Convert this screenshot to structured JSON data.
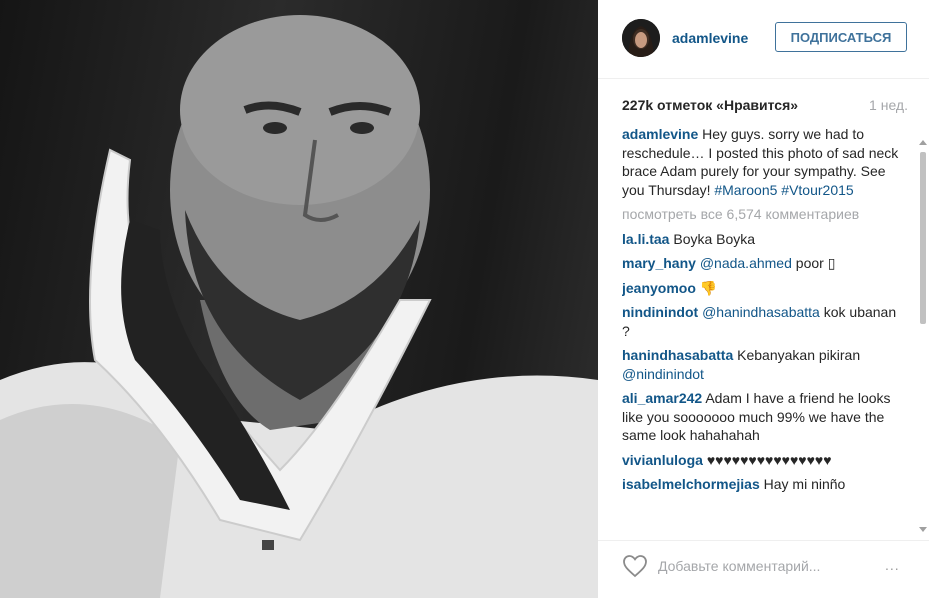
{
  "photo": {
    "description_icon": "photo-icon"
  },
  "header": {
    "username": "adamlevine",
    "follow_label": "ПОДПИСАТЬСЯ"
  },
  "stats": {
    "likes": "227k отметок «Нравится»",
    "ago": "1 нед."
  },
  "caption": {
    "user": "adamlevine",
    "text": "Hey guys. sorry we had to reschedule… I posted this photo of sad neck brace Adam purely for your sympathy. See you Thursday!",
    "tag1": "#Maroon5",
    "tag2": "#Vtour2015"
  },
  "view_all": "посмотреть все 6,574 комментариев",
  "comments": [
    {
      "user": "la.li.taa",
      "mention": "",
      "text": "Boyka Boyka"
    },
    {
      "user": "mary_hany",
      "mention": "@nada.ahmed",
      "text": "poor ▯"
    },
    {
      "user": "jeanyomoo",
      "mention": "",
      "text": "👎"
    },
    {
      "user": "nindinindot",
      "mention": "@hanindhasabatta",
      "text": "kok ubanan ?"
    },
    {
      "user": "hanindhasabatta",
      "mention": "",
      "text": "Kebanyakan pikiran",
      "mention2": "@nindinindot"
    },
    {
      "user": "ali_amar242",
      "mention": "",
      "text": "Adam I have a friend he looks like you sooooooo much 99% we have the same look hahahahah"
    },
    {
      "user": "vivianluloga",
      "mention": "",
      "text": "♥♥♥♥♥♥♥♥♥♥♥♥♥♥♥"
    },
    {
      "user": "isabelmelchormejias",
      "mention": "",
      "text": "Hay mi ninño"
    }
  ],
  "footer": {
    "comment_placeholder": "Добавьте комментарий...",
    "more_options": "..."
  },
  "colors": {
    "link": "#125688",
    "follow_border": "#3f729b",
    "muted": "#a5a7aa"
  }
}
